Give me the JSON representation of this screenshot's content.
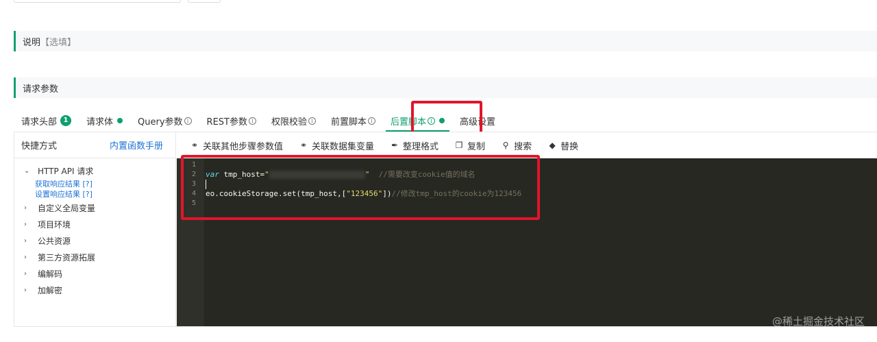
{
  "sections": {
    "desc_title": "说明",
    "desc_hint": "【选填】",
    "params_title": "请求参数"
  },
  "tabs": [
    {
      "label": "请求头部",
      "badge": "1"
    },
    {
      "label": "请求体"
    },
    {
      "label": "Query参数"
    },
    {
      "label": "REST参数"
    },
    {
      "label": "权限校验"
    },
    {
      "label": "前置脚本"
    },
    {
      "label": "后置脚本",
      "active": true
    },
    {
      "label": "高级设置"
    }
  ],
  "sidebar": {
    "title": "快捷方式",
    "link": "内置函数手册",
    "items": [
      {
        "label": "HTTP API 请求",
        "expanded": true,
        "children": [
          "获取响应结果 [?]",
          "设置响应结果 [?]"
        ]
      },
      {
        "label": "自定义全局变量"
      },
      {
        "label": "项目环境"
      },
      {
        "label": "公共资源"
      },
      {
        "label": "第三方资源拓展"
      },
      {
        "label": "编解码"
      },
      {
        "label": "加解密"
      }
    ]
  },
  "toolbar": {
    "link_steps": "关联其他步骤参数值",
    "link_dataset": "关联数据集变量",
    "format": "整理格式",
    "copy": "复制",
    "search": "搜索",
    "replace": "替换"
  },
  "code": {
    "line_numbers": [
      "1",
      "2",
      "3",
      "4",
      "5"
    ],
    "line2_kw": "var",
    "line2_var": " tmp_host=",
    "line2_quote_open": "\"",
    "line2_quote_close": "\"",
    "line2_comment": "  //需要改变cookie值的域名",
    "line4_code": "eo.cookieStorage.set(tmp_host,[",
    "line4_str": "\"123456\"",
    "line4_end": "])",
    "line4_comment": "//修改tmp_host的cookie为123456"
  },
  "watermark": "@稀土掘金技术社区",
  "colors": {
    "accent": "#0e9f6e",
    "highlight": "#e0162b",
    "link": "#1f73d6",
    "editor_bg": "#272822"
  }
}
